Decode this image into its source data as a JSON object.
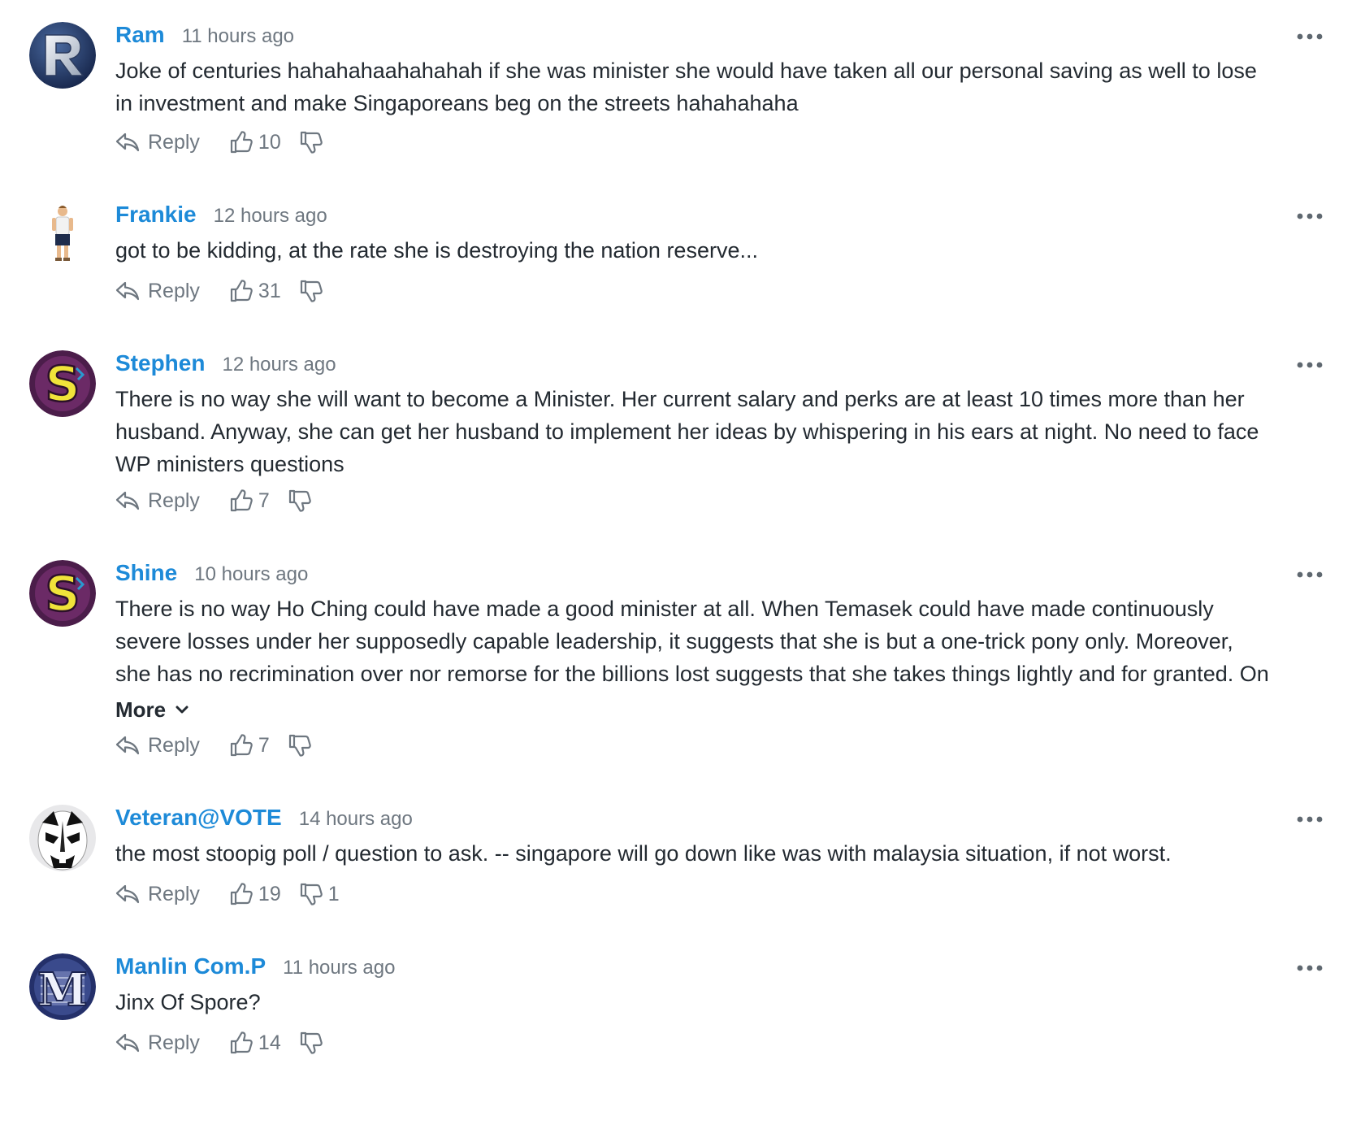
{
  "labels": {
    "reply": "Reply",
    "more": "More"
  },
  "comments": [
    {
      "author": "Ram",
      "time": "11 hours ago",
      "avatar": "letter-R-avatar",
      "lines": [
        "Joke of centuries hahahahaahahahah if she was minister she would have taken all our personal saving as well to lose",
        "in investment and make Singaporeans beg on the streets hahahahaha"
      ],
      "likes": "10",
      "dislikes": ""
    },
    {
      "author": "Frankie",
      "time": "12 hours ago",
      "avatar": "person-figure-avatar",
      "lines": [
        "got to be kidding, at the rate she is destroying the nation reserve..."
      ],
      "likes": "31",
      "dislikes": ""
    },
    {
      "author": "Stephen",
      "time": "12 hours ago",
      "avatar": "letter-S-avatar",
      "lines": [
        "There is no way she will want to become a Minister. Her current salary and perks are at least 10 times more than her",
        "husband. Anyway, she can get her husband to implement her ideas by whispering in his ears at night. No need to face",
        "WP ministers questions"
      ],
      "likes": "7",
      "dislikes": ""
    },
    {
      "author": "Shine",
      "time": "10 hours ago",
      "avatar": "letter-S-avatar",
      "lines": [
        "There is no way Ho Ching could have made a good minister at all. When Temasek could have made continuously",
        "severe losses under her supposedly capable leadership, it suggests that she is but a one-trick pony only. Moreover,",
        "she has no recrimination over nor remorse for the billions lost suggests that she takes things lightly and for granted. On"
      ],
      "truncated": true,
      "likes": "7",
      "dislikes": ""
    },
    {
      "author": "Veteran@VOTE",
      "time": "14 hours ago",
      "avatar": "opera-mask-avatar",
      "lines": [
        "the most stoopig poll / question to ask. -- singapore will go down like was with malaysia situation, if not worst."
      ],
      "likes": "19",
      "dislikes": "1"
    },
    {
      "author": "Manlin Com.P",
      "time": "11 hours ago",
      "avatar": "letter-M-avatar",
      "lines": [
        "Jinx Of Spore?"
      ],
      "likes": "14",
      "dislikes": ""
    }
  ],
  "colors": {
    "author": "#1d8ad8",
    "meta": "#6e7780",
    "text": "#232a31"
  }
}
